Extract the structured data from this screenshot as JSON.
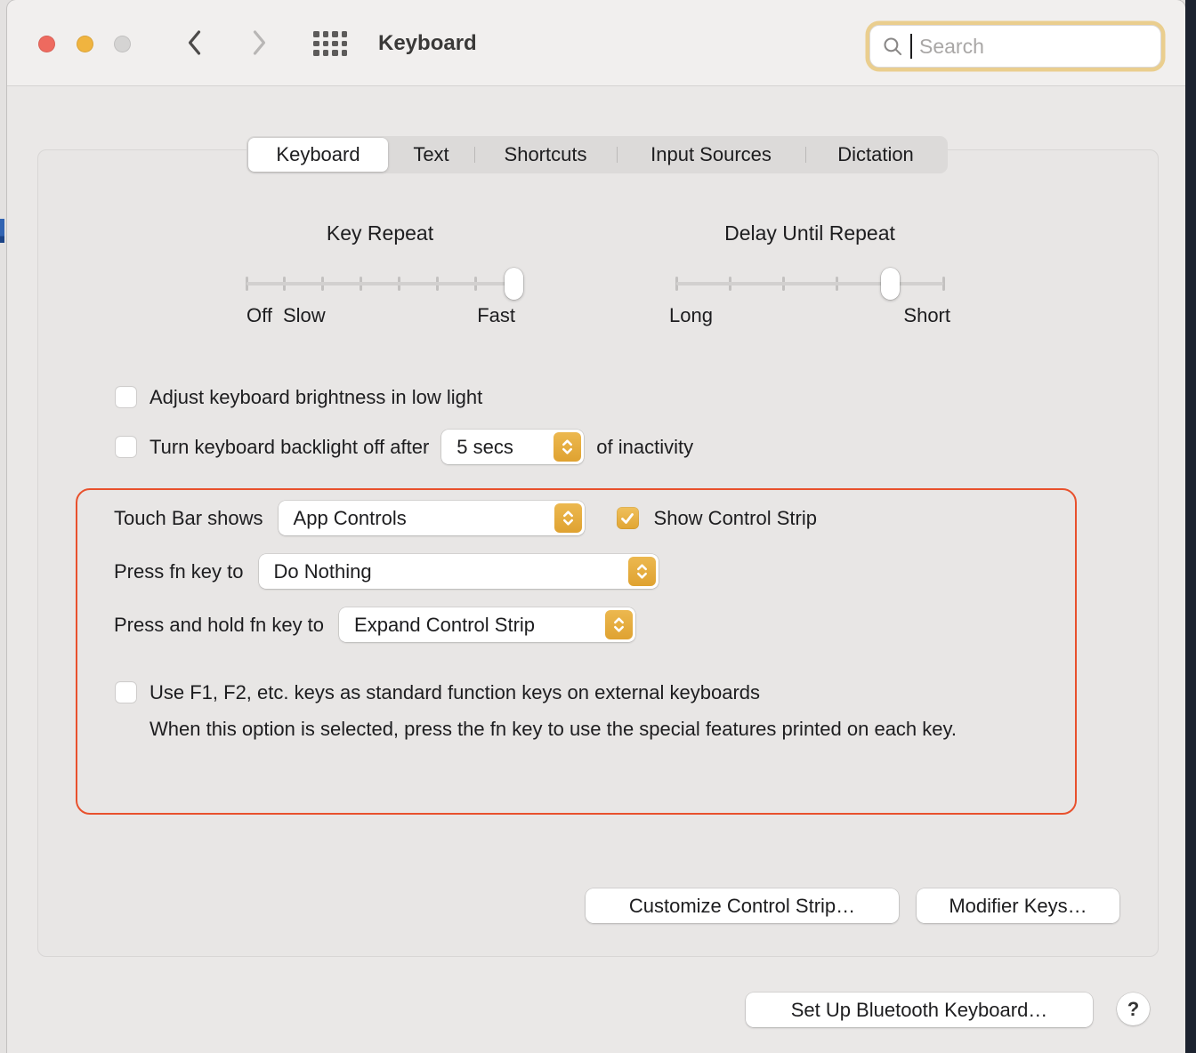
{
  "window": {
    "title": "Keyboard",
    "search": {
      "placeholder": "Search"
    }
  },
  "tabs": [
    {
      "label": "Keyboard",
      "selected": true
    },
    {
      "label": "Text",
      "selected": false
    },
    {
      "label": "Shortcuts",
      "selected": false
    },
    {
      "label": "Input Sources",
      "selected": false
    },
    {
      "label": "Dictation",
      "selected": false
    }
  ],
  "sliders": {
    "key_repeat": {
      "title": "Key Repeat",
      "tick_count": 8,
      "value_index": 8,
      "labels": {
        "off": "Off",
        "slow": "Slow",
        "fast": "Fast"
      }
    },
    "delay": {
      "title": "Delay Until Repeat",
      "tick_count": 6,
      "value_index": 5,
      "labels": {
        "long": "Long",
        "short": "Short"
      }
    }
  },
  "options": {
    "adjust_brightness": {
      "label": "Adjust keyboard brightness in low light",
      "checked": false
    },
    "backlight_off": {
      "label_before": "Turn keyboard backlight off after",
      "value": "5 secs",
      "label_after": "of inactivity",
      "checked": false
    }
  },
  "touch_bar": {
    "shows_label": "Touch Bar shows",
    "shows_value": "App Controls",
    "control_strip": {
      "label": "Show Control Strip",
      "checked": true
    },
    "fn_label": "Press fn key to",
    "fn_value": "Do Nothing",
    "hold_fn_label": "Press and hold fn key to",
    "hold_fn_value": "Expand Control Strip",
    "f_keys": {
      "label": "Use F1, F2, etc. keys as standard function keys on external keyboards",
      "checked": false,
      "description": "When this option is selected, press the fn key to use the special features printed on each key."
    }
  },
  "buttons": {
    "customize": "Customize Control Strip…",
    "modifier": "Modifier Keys…",
    "bluetooth": "Set Up Bluetooth Keyboard…",
    "help": "?"
  },
  "colors": {
    "accent_gold": "#E2A93D",
    "focus_ring": "#EACE8E",
    "highlight_border": "#E8512D",
    "traffic_red": "#EE6A5F",
    "traffic_yellow": "#F0B43F",
    "traffic_disabled": "#D5D4D3"
  }
}
